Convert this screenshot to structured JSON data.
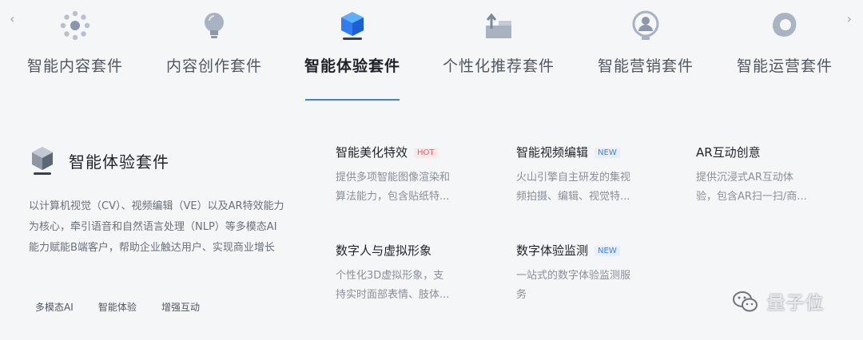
{
  "nav": {
    "prev_icon": "chevron-left-icon",
    "next_icon": "chevron-right-icon",
    "prev_glyph": "‹",
    "next_glyph": "›",
    "tabs": [
      {
        "label": "智能内容套件",
        "icon": "dots-circle-icon"
      },
      {
        "label": "内容创作套件",
        "icon": "lightbulb-icon"
      },
      {
        "label": "智能体验套件",
        "icon": "cube-icon",
        "active": true
      },
      {
        "label": "个性化推荐套件",
        "icon": "upload-box-icon"
      },
      {
        "label": "智能营销套件",
        "icon": "badge-person-icon"
      },
      {
        "label": "智能运营套件",
        "icon": "blob-icon"
      }
    ],
    "accent_color": "#3f7ff5"
  },
  "intro": {
    "title": "智能体验套件",
    "description": "以计算机视觉（CV）、视频编辑（VE）以及AR特效能力为核心，牵引语音和自然语言处理（NLP）等多模态AI能力赋能B端客户，帮助企业触达用户、实现商业增长",
    "tags": [
      "多模态AI",
      "智能体验",
      "增强互动"
    ]
  },
  "products": [
    {
      "name": "智能美化特效",
      "badge": "HOT",
      "badge_type": "hot",
      "desc_line1": "提供多项智能图像渲染和",
      "desc_line2": "算法能力，包含贴纸特..."
    },
    {
      "name": "智能视频编辑",
      "badge": "NEW",
      "badge_type": "new",
      "desc_line1": "火山引擎自主研发的集视",
      "desc_line2": "频拍摄、编辑、视觉特..."
    },
    {
      "name": "AR互动创意",
      "badge": "",
      "badge_type": "",
      "desc_line1": "提供沉浸式AR互动体",
      "desc_line2": "验，包含AR扫一扫/商..."
    },
    {
      "name": "数字人与虚拟形象",
      "badge": "",
      "badge_type": "",
      "desc_line1": "个性化3D虚拟形象，支",
      "desc_line2": "持实时面部表情、肢体..."
    },
    {
      "name": "数字体验监测",
      "badge": "NEW",
      "badge_type": "new",
      "desc_line1": "一站式的数字体验监测服",
      "desc_line2": "务"
    }
  ],
  "watermark": {
    "text": "量子位",
    "icon": "wechat-icon"
  }
}
